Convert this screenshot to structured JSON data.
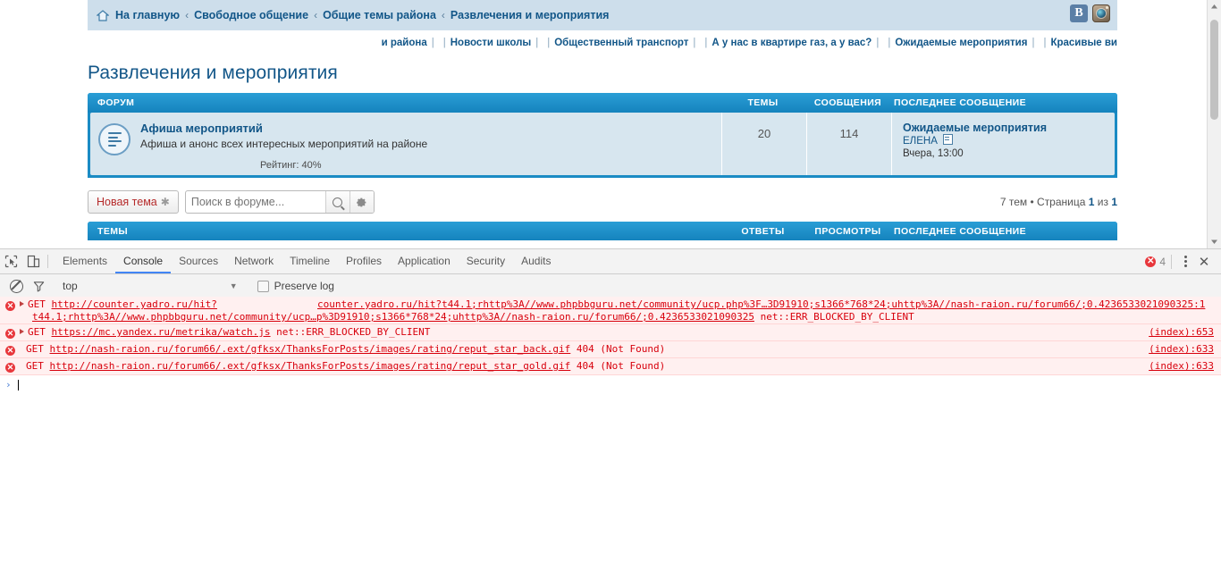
{
  "forum": {
    "breadcrumb": {
      "home_icon": "home-icon",
      "items": [
        "На главную",
        "Свободное общение",
        "Общие темы района",
        "Развлечения и мероприятия"
      ],
      "separator": "‹"
    },
    "social": {
      "vk_label": "B",
      "vk_name": "vk-icon",
      "instagram_name": "instagram-icon"
    },
    "navlinks": {
      "leading_partial": "и района",
      "items": [
        "Новости школы",
        "Общественный транспорт",
        "А у нас в квартире газ, а у вас?",
        "Ожидаемые мероприятия",
        "Красивые ви"
      ],
      "separator": "|"
    },
    "page_title": "Развлечения и мероприятия",
    "forum_table": {
      "headers": {
        "forum": "ФОРУМ",
        "topics": "ТЕМЫ",
        "posts": "СООБЩЕНИЯ",
        "last_post": "ПОСЛЕДНЕЕ СООБЩЕНИЕ"
      },
      "row": {
        "title": "Афиша мероприятий",
        "description": "Афиша и анонс всех интересных мероприятий на районе",
        "rating": "Рейтинг: 40%",
        "topics": "20",
        "posts": "114",
        "last_post_title": "Ожидаемые мероприятия",
        "last_post_author": "ЕЛЕНА",
        "last_post_date": "Вчера, 13:00"
      }
    },
    "toolbar": {
      "new_topic_label": "Новая тема",
      "new_topic_star": "✱",
      "search_placeholder": "Поиск в форуме...",
      "search_value": "",
      "search_button_name": "search-icon",
      "settings_button_name": "gear-icon",
      "pagination_prefix": "7 тем • Страница ",
      "pagination_current": "1",
      "pagination_mid": " из ",
      "pagination_total": "1"
    },
    "topics_table": {
      "headers": {
        "topics": "ТЕМЫ",
        "answers": "ОТВЕТЫ",
        "views": "ПРОСМОТРЫ",
        "last_post": "ПОСЛЕДНЕЕ СООБЩЕНИЕ"
      }
    }
  },
  "devtools": {
    "tabs": [
      "Elements",
      "Console",
      "Sources",
      "Network",
      "Timeline",
      "Profiles",
      "Application",
      "Security",
      "Audits"
    ],
    "active_tab": "Console",
    "error_count": "4",
    "filterbar": {
      "context": "top",
      "caret": "▼",
      "preserve_log_label": "Preserve log",
      "preserve_log_checked": false
    },
    "console": {
      "prompt_chevron": "›",
      "messages": [
        {
          "expandable": true,
          "verb": "GET ",
          "url": "http://counter.yadro.ru/hit?",
          "far_text": "counter.yadro.ru/hit?t44.1;rhttp%3A//www.phpbbguru.net/community/ucp.php%3F…3D91910;s1366*768*24;uhttp%3A//nash-raion.ru/forum66/;0.4236533021090325:1",
          "second_line_url": "t44.1;rhttp%3A//www.phpbbguru.net/community/ucp…p%3D91910;s1366*768*24;uhttp%3A//nash-raion.ru/forum66/;0.4236533021090325",
          "second_line_status": " net::ERR_BLOCKED_BY_CLIENT",
          "source": ""
        },
        {
          "expandable": true,
          "verb": "GET ",
          "url": "https://mc.yandex.ru/metrika/watch.js",
          "status": " net::ERR_BLOCKED_BY_CLIENT",
          "source": "(index):653"
        },
        {
          "expandable": false,
          "verb": "GET ",
          "url": "http://nash-raion.ru/forum66/.ext/gfksx/ThanksForPosts/images/rating/reput_star_back.gif",
          "status": " 404 (Not Found)",
          "source": "(index):633"
        },
        {
          "expandable": false,
          "verb": "GET ",
          "url": "http://nash-raion.ru/forum66/.ext/gfksx/ThanksForPosts/images/rating/reput_star_gold.gif",
          "status": " 404 (Not Found)",
          "source": "(index):633"
        }
      ]
    }
  },
  "colors": {
    "forum_blue": "#1583bd",
    "link_blue": "#125688",
    "breadcrumb_bg": "#cddeeb",
    "row_bg": "#d7e6ef",
    "error_red": "#d8000c",
    "devtools_accent": "#4285f4"
  }
}
